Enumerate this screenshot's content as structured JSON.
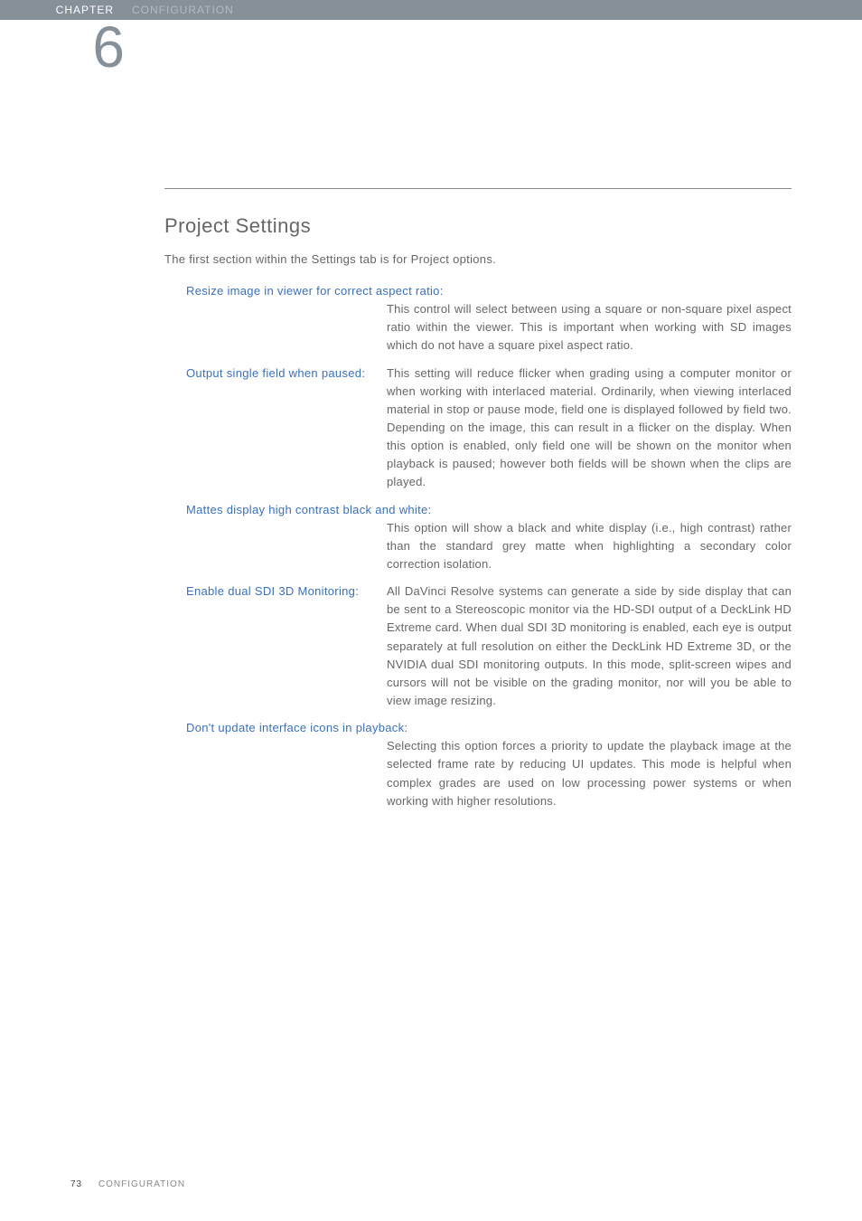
{
  "header": {
    "chapter_label": "CHAPTER",
    "chapter_title": "CONFIGURATION",
    "chapter_number": "6"
  },
  "section_title": "Project Settings",
  "intro": "The first section within the Settings tab is for Project options.",
  "settings": [
    {
      "label": "Resize image in viewer for correct aspect ratio:",
      "body": "This control will select between using a square or non-square pixel aspect ratio within the viewer. This is important when working with SD images which do not have a square pixel aspect ratio."
    },
    {
      "label": "Output single field when paused:",
      "body": "This setting will reduce flicker when grading using a computer monitor or when working with interlaced material. Ordinarily, when viewing interlaced material in stop or pause mode, field one is displayed followed by field two. Depending on the image, this can result in a flicker on the display. When this option is enabled, only field one will be shown on the monitor when playback is paused; however both fields will be shown when the clips are played."
    },
    {
      "label": "Mattes display high contrast black and white:",
      "body": "This option will show a black and white display (i.e., high contrast) rather than the standard grey matte when highlighting a secondary color correction isolation."
    },
    {
      "label": "Enable dual SDI 3D Monitoring:",
      "body": "All DaVinci Resolve systems can generate a side by side display that can be sent to a Stereoscopic monitor via the HD-SDI output of a DeckLink HD Extreme card. When dual SDI 3D monitoring is enabled, each eye is output separately at full resolution on either the DeckLink HD Extreme 3D, or the NVIDIA dual SDI monitoring outputs. In this mode, split-screen wipes and cursors will not be visible on the grading monitor, nor will you be able to view image resizing."
    },
    {
      "label": "Don't update interface icons in playback:",
      "body": "Selecting this option forces a priority to update the playback image at the selected frame rate by reducing UI updates. This mode is helpful when complex grades are used on low processing power systems or when working with higher resolutions."
    }
  ],
  "footer": {
    "page_number": "73",
    "footer_title": "CONFIGURATION"
  }
}
